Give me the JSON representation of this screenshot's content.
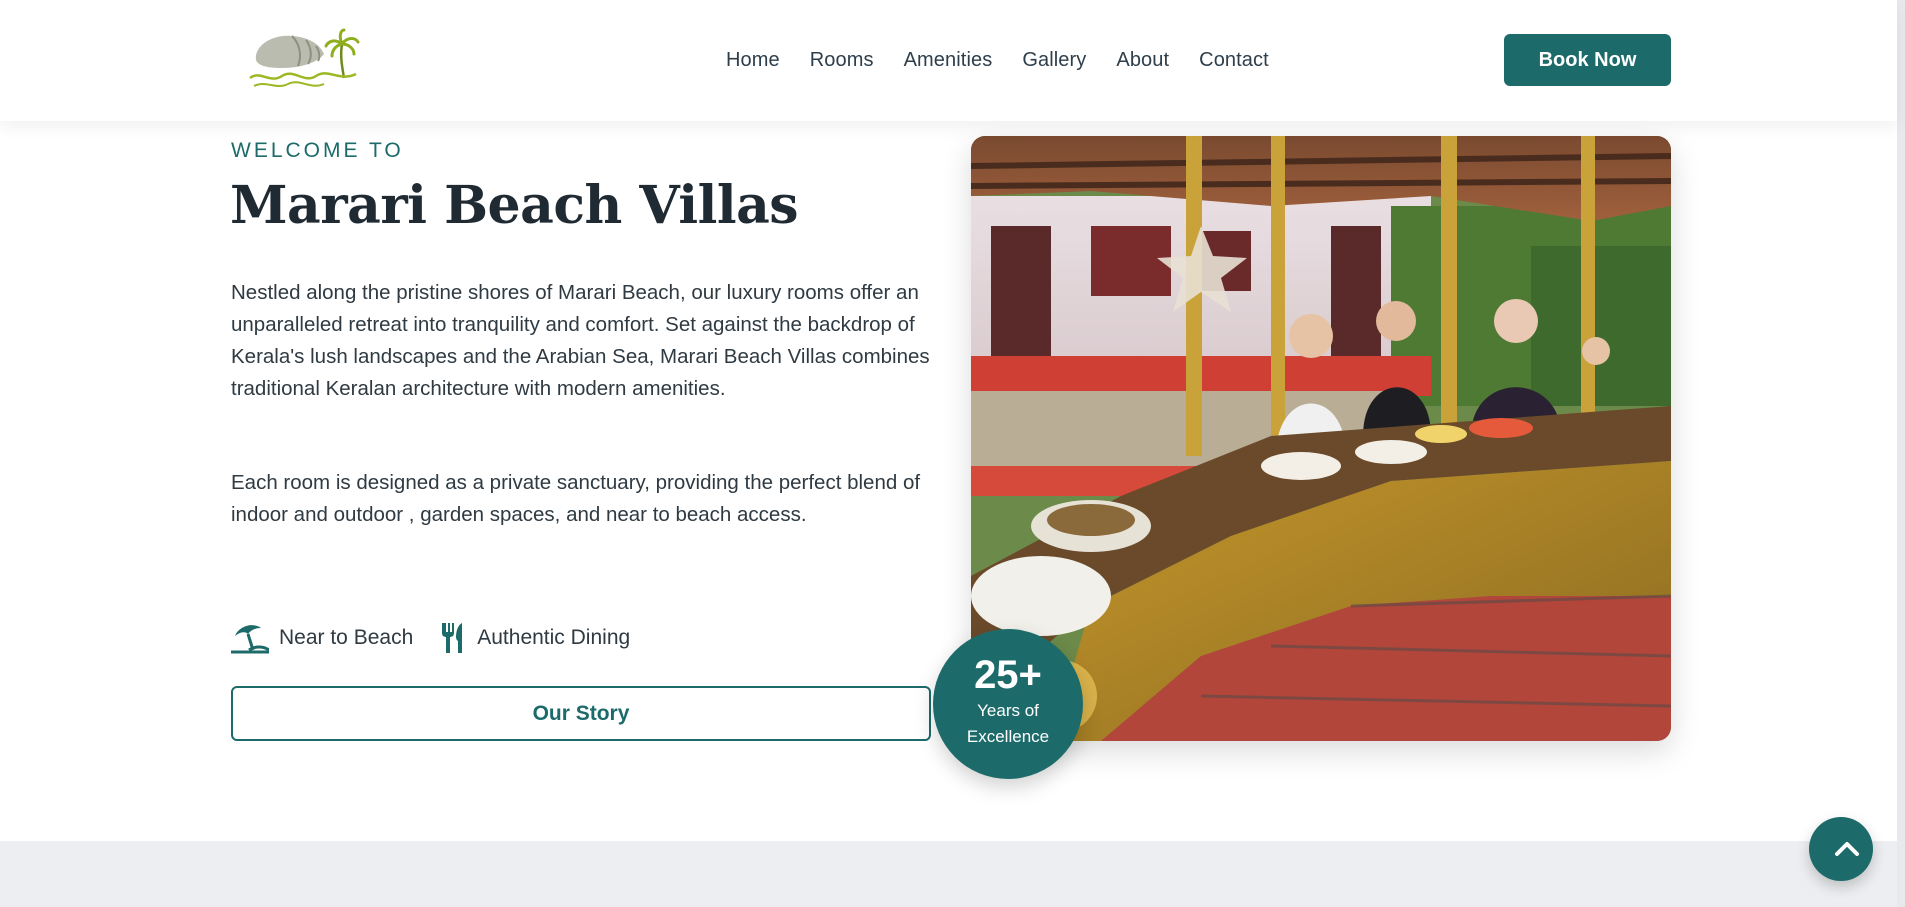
{
  "nav": {
    "items": [
      "Home",
      "Rooms",
      "Amenities",
      "Gallery",
      "About",
      "Contact"
    ],
    "cta": "Book Now"
  },
  "hero": {
    "eyebrow": "WELCOME TO",
    "title": "Marari Beach Villas",
    "paragraphs": [
      "Nestled along the pristine shores of Marari Beach, our luxury rooms offer an unparalleled retreat into tranquility and comfort. Set against the backdrop of Kerala's lush landscapes and the Arabian Sea, Marari Beach Villas combines traditional Keralan architecture with modern amenities.",
      "Each room is designed as a private sanctuary, providing the perfect blend of indoor and outdoor , garden spaces, and near to beach access."
    ],
    "features": [
      {
        "label": "Near to Beach",
        "icon": "beach-umbrella-icon"
      },
      {
        "label": "Authentic Dining",
        "icon": "fork-knife-icon"
      }
    ],
    "button": "Our Story"
  },
  "badge": {
    "number": "25+",
    "line1": "Years of",
    "line2": "Excellence"
  },
  "colors": {
    "accent": "#1c6b6a",
    "text": "#1f2a33",
    "band": "#eceef1"
  }
}
